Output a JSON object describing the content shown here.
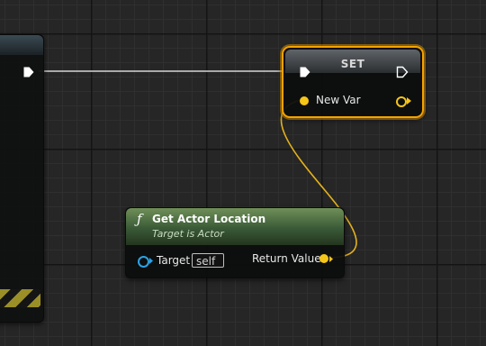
{
  "graph": {
    "set_node": {
      "title": "SET",
      "input_pin_label": "New Var",
      "accent_color": "#f5a200"
    },
    "get_actor_location_node": {
      "title": "Get Actor Location",
      "subtitle": "Target is Actor",
      "function_glyph": "ƒ",
      "target_pin_label": "Target",
      "target_default_value": "self",
      "return_pin_label": "Return Value",
      "header_color": "#4a6b3f"
    },
    "colors": {
      "exec_wire": "#d6d6d6",
      "vector_pin": "#f5c518",
      "object_pin": "#2aa3e6"
    },
    "icons": [
      "exec-pin-icon",
      "function-icon",
      "vector-pin-icon",
      "object-pin-icon"
    ]
  }
}
